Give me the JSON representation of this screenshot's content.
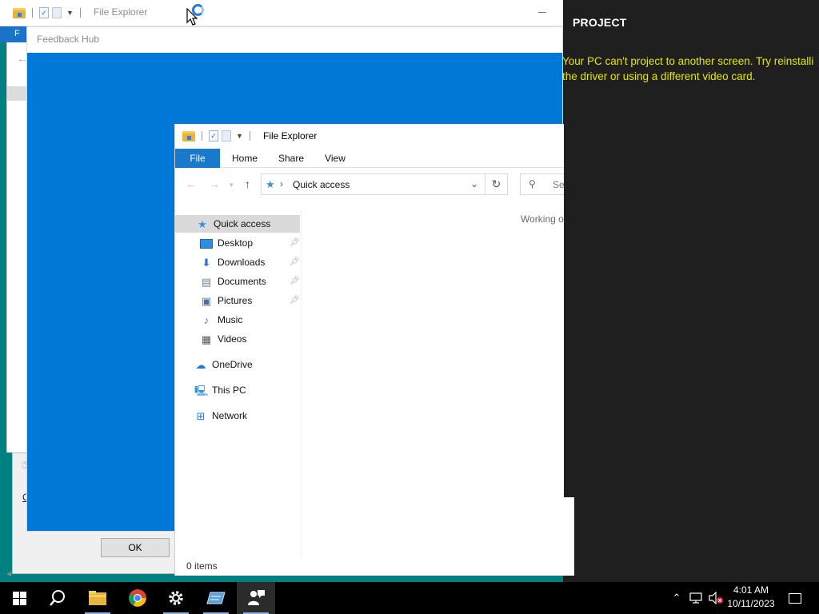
{
  "background_explorer": {
    "title": "File Explorer",
    "ribbon_letter": "F"
  },
  "back_dialog": {
    "underlined_letter": "C",
    "ok_label": "OK"
  },
  "feedback_hub": {
    "title": "Feedback Hub",
    "color": "#0078d7"
  },
  "project_panel": {
    "heading": "PROJECT",
    "message_line1": "Your PC can't project to another screen. Try reinstalli",
    "message_line2": "the driver or using a different video card.",
    "message_color": "#e6e600"
  },
  "explorer": {
    "title": "File Explorer",
    "ribbon_tabs": [
      "File",
      "Home",
      "Share",
      "View"
    ],
    "address": "Quick access",
    "search_placeholder": "Se",
    "content_message": "Working o",
    "status": "0 items",
    "nav": [
      {
        "label": "Quick access",
        "icon": "star-icon"
      },
      {
        "label": "Desktop",
        "icon": "desktop-icon",
        "pinned": true
      },
      {
        "label": "Downloads",
        "icon": "download-icon",
        "pinned": true
      },
      {
        "label": "Documents",
        "icon": "documents-icon",
        "pinned": true
      },
      {
        "label": "Pictures",
        "icon": "pictures-icon",
        "pinned": true
      },
      {
        "label": "Music",
        "icon": "music-icon"
      },
      {
        "label": "Videos",
        "icon": "videos-icon"
      },
      {
        "label": "OneDrive",
        "icon": "cloud-icon"
      },
      {
        "label": "This PC",
        "icon": "computer-icon"
      },
      {
        "label": "Network",
        "icon": "network-icon"
      }
    ]
  },
  "taskbar": {
    "apps": [
      "start-icon",
      "search-icon",
      "file-explorer-icon",
      "chrome-icon",
      "settings-icon",
      "app-icon",
      "feedback-hub-icon"
    ],
    "time": "4:01 AM",
    "date": "10/11/2023",
    "accent": "#000000"
  }
}
